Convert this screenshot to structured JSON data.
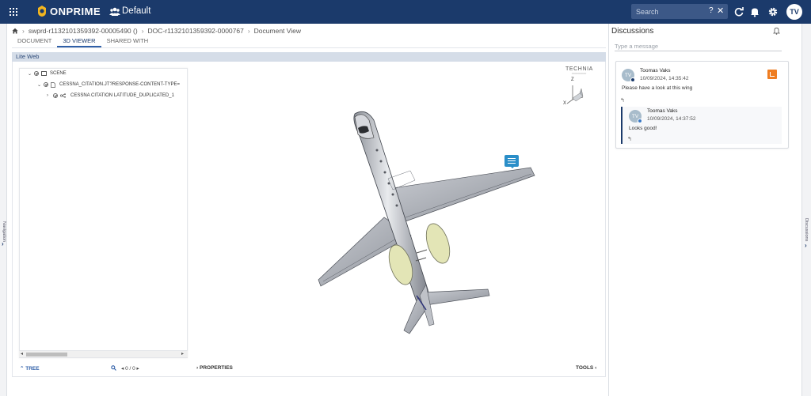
{
  "app": {
    "brand": "ONPRIME",
    "workspace": "Default",
    "search_placeholder": "Search",
    "search_help": "?",
    "search_clear": "✕",
    "user_initials": "TV"
  },
  "rails": {
    "left_label": "Navigation",
    "right_label": "Discussions"
  },
  "breadcrumb": [
    "swprd-r1132101359392-00005490 ()",
    "DOC-r1132101359392-0000767",
    "Document View"
  ],
  "tabs": [
    {
      "label": "DOCUMENT",
      "active": false
    },
    {
      "label": "3D VIEWER",
      "active": true
    },
    {
      "label": "SHARED WITH",
      "active": false
    }
  ],
  "viewer": {
    "title": "Lite Web",
    "tree": [
      {
        "label": "SCENE",
        "expanded": true
      },
      {
        "label": "CESSNA_CITATION.JT?RESPONSE-CONTENT-TYPE=",
        "expanded": true
      },
      {
        "label": "CESSNA CITATION LATITUDE_DUPLICATED_1",
        "expanded": false
      }
    ],
    "tree_toggle": "TREE",
    "pager": "0 / 0",
    "properties_toggle": "PROPERTIES",
    "tools_toggle": "TOOLS",
    "brand_mark": "TECHNIA",
    "axis_z": "Z",
    "axis_x": "X",
    "colors": {
      "accent": "#2f5fa8",
      "header": "#1b3a6b",
      "annotation": "#2a8ec8",
      "engine": "#e6e8b8"
    }
  },
  "discussions": {
    "title": "Discussions",
    "input_placeholder": "Type a message",
    "threads": [
      {
        "initials": "TV",
        "author": "Toomas Vaks",
        "timestamp": "10/09/2024, 14:35:42",
        "text": "Please have a look at this wing",
        "reply_glyph": "↰",
        "replies": [
          {
            "initials": "TV",
            "author": "Toomas Vaks",
            "timestamp": "10/09/2024, 14:37:52",
            "text": "Looks good!",
            "reply_glyph": "↰"
          }
        ]
      }
    ]
  }
}
